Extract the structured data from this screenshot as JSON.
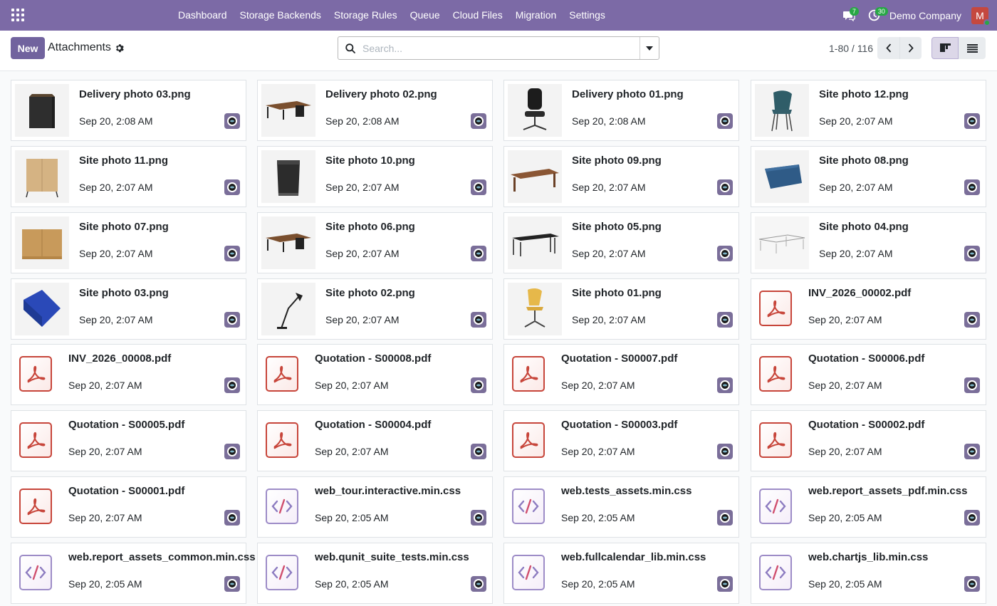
{
  "navbar": {
    "menu": [
      "Dashboard",
      "Storage Backends",
      "Storage Rules",
      "Queue",
      "Cloud Files",
      "Migration",
      "Settings"
    ],
    "messages_count": "7",
    "activities_count": "30",
    "company": "Demo Company",
    "avatar_letter": "M"
  },
  "control": {
    "new_label": "New",
    "title": "Attachments",
    "search_placeholder": "Search...",
    "pager": "1-80 / 116"
  },
  "cards": [
    {
      "name": "Delivery photo 03.png",
      "date": "Sep 20, 2:08 AM",
      "kind": "image",
      "thumb": "cabinet-black"
    },
    {
      "name": "Delivery photo 02.png",
      "date": "Sep 20, 2:08 AM",
      "kind": "image",
      "thumb": "desk-corner"
    },
    {
      "name": "Delivery photo 01.png",
      "date": "Sep 20, 2:08 AM",
      "kind": "image",
      "thumb": "office-chair"
    },
    {
      "name": "Site photo 12.png",
      "date": "Sep 20, 2:07 AM",
      "kind": "image",
      "thumb": "chair-teal"
    },
    {
      "name": "Site photo 11.png",
      "date": "Sep 20, 2:07 AM",
      "kind": "image",
      "thumb": "cabinet-wood"
    },
    {
      "name": "Site photo 10.png",
      "date": "Sep 20, 2:07 AM",
      "kind": "image",
      "thumb": "bin-black"
    },
    {
      "name": "Site photo 09.png",
      "date": "Sep 20, 2:07 AM",
      "kind": "image",
      "thumb": "desk-wood"
    },
    {
      "name": "Site photo 08.png",
      "date": "Sep 20, 2:07 AM",
      "kind": "image",
      "thumb": "tray-blue"
    },
    {
      "name": "Site photo 07.png",
      "date": "Sep 20, 2:07 AM",
      "kind": "image",
      "thumb": "sideboard"
    },
    {
      "name": "Site photo 06.png",
      "date": "Sep 20, 2:07 AM",
      "kind": "image",
      "thumb": "desk-corner"
    },
    {
      "name": "Site photo 05.png",
      "date": "Sep 20, 2:07 AM",
      "kind": "image",
      "thumb": "desk-white"
    },
    {
      "name": "Site photo 04.png",
      "date": "Sep 20, 2:07 AM",
      "kind": "image",
      "thumb": "wire-desk"
    },
    {
      "name": "Site photo 03.png",
      "date": "Sep 20, 2:07 AM",
      "kind": "image",
      "thumb": "box-blue"
    },
    {
      "name": "Site photo 02.png",
      "date": "Sep 20, 2:07 AM",
      "kind": "image",
      "thumb": "lamp"
    },
    {
      "name": "Site photo 01.png",
      "date": "Sep 20, 2:07 AM",
      "kind": "image",
      "thumb": "chair-yellow"
    },
    {
      "name": "INV_2026_00002.pdf",
      "date": "Sep 20, 2:07 AM",
      "kind": "pdf"
    },
    {
      "name": "INV_2026_00008.pdf",
      "date": "Sep 20, 2:07 AM",
      "kind": "pdf"
    },
    {
      "name": "Quotation - S00008.pdf",
      "date": "Sep 20, 2:07 AM",
      "kind": "pdf"
    },
    {
      "name": "Quotation - S00007.pdf",
      "date": "Sep 20, 2:07 AM",
      "kind": "pdf"
    },
    {
      "name": "Quotation - S00006.pdf",
      "date": "Sep 20, 2:07 AM",
      "kind": "pdf"
    },
    {
      "name": "Quotation - S00005.pdf",
      "date": "Sep 20, 2:07 AM",
      "kind": "pdf"
    },
    {
      "name": "Quotation - S00004.pdf",
      "date": "Sep 20, 2:07 AM",
      "kind": "pdf"
    },
    {
      "name": "Quotation - S00003.pdf",
      "date": "Sep 20, 2:07 AM",
      "kind": "pdf"
    },
    {
      "name": "Quotation - S00002.pdf",
      "date": "Sep 20, 2:07 AM",
      "kind": "pdf"
    },
    {
      "name": "Quotation - S00001.pdf",
      "date": "Sep 20, 2:07 AM",
      "kind": "pdf"
    },
    {
      "name": "web_tour.interactive.min.css",
      "date": "Sep 20, 2:05 AM",
      "kind": "css"
    },
    {
      "name": "web.tests_assets.min.css",
      "date": "Sep 20, 2:05 AM",
      "kind": "css"
    },
    {
      "name": "web.report_assets_pdf.min.css",
      "date": "Sep 20, 2:05 AM",
      "kind": "css"
    },
    {
      "name": "web.report_assets_common.min.css",
      "date": "Sep 20, 2:05 AM",
      "kind": "css"
    },
    {
      "name": "web.qunit_suite_tests.min.css",
      "date": "Sep 20, 2:05 AM",
      "kind": "css"
    },
    {
      "name": "web.fullcalendar_lib.min.css",
      "date": "Sep 20, 2:05 AM",
      "kind": "css"
    },
    {
      "name": "web.chartjs_lib.min.css",
      "date": "Sep 20, 2:05 AM",
      "kind": "css"
    }
  ],
  "colors": {
    "navbar": "#7c6aa6",
    "primary": "#71639e",
    "pdf": "#c7453a",
    "css": "#9d8cc7"
  }
}
